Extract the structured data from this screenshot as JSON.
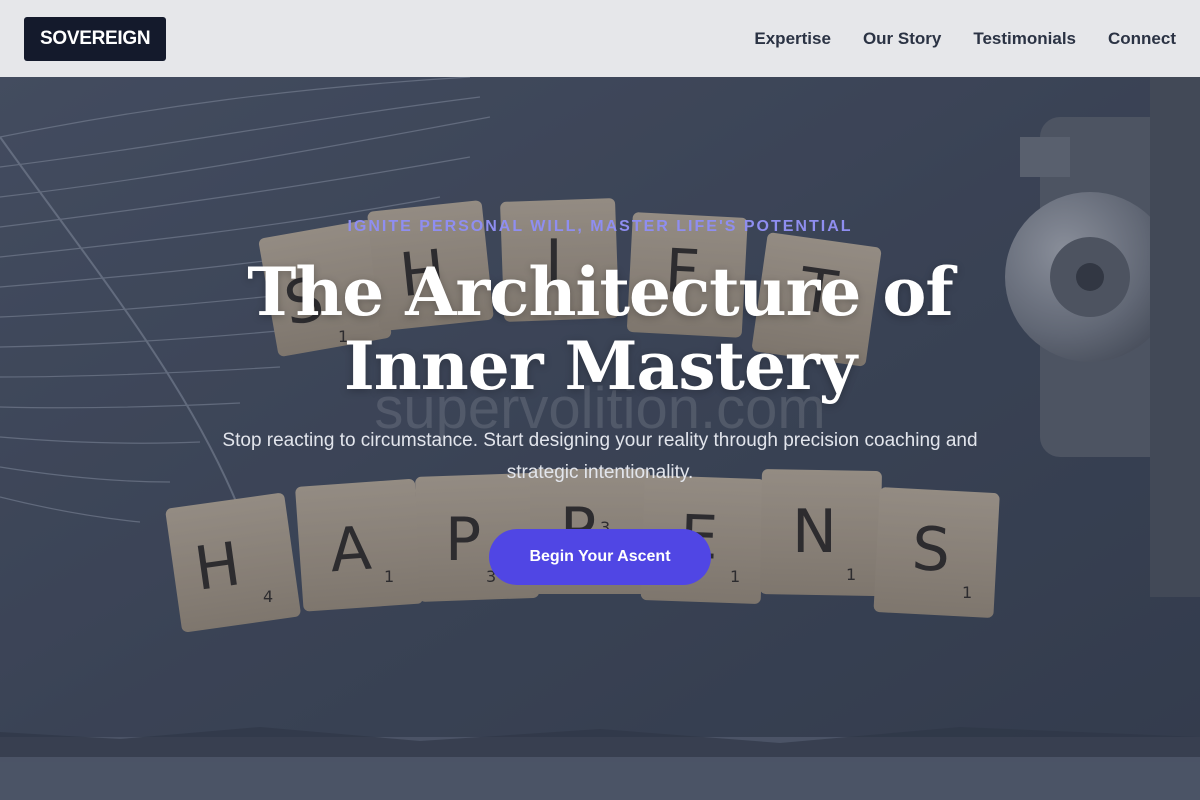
{
  "header": {
    "logo_text": "SOVEREIGN",
    "nav": [
      {
        "label": "Expertise"
      },
      {
        "label": "Our Story"
      },
      {
        "label": "Testimonials"
      },
      {
        "label": "Connect"
      }
    ]
  },
  "hero": {
    "eyebrow": "IGNITE PERSONAL WILL, MASTER LIFE'S POTENTIAL",
    "title": "The Architecture of Inner Mastery",
    "subtitle": "Stop reacting to circumstance. Start designing your reality through precision coaching and strategic intentionality.",
    "cta_label": "Begin Your Ascent",
    "background": {
      "top_tiles": [
        "S",
        "H",
        "I",
        "F",
        "T"
      ],
      "bottom_tiles": [
        "H",
        "A",
        "P",
        "P",
        "E",
        "N",
        "S"
      ],
      "tile_points": [
        "1",
        "4",
        "1",
        "3",
        "3",
        "1",
        "1",
        "1"
      ],
      "watermark": "supervolition.com"
    }
  },
  "colors": {
    "header_bg": "#e6e7ea",
    "logo_bg": "#141a2c",
    "accent": "#5046e4",
    "eyebrow": "#8f8ef0",
    "slate": "#3c4556"
  }
}
